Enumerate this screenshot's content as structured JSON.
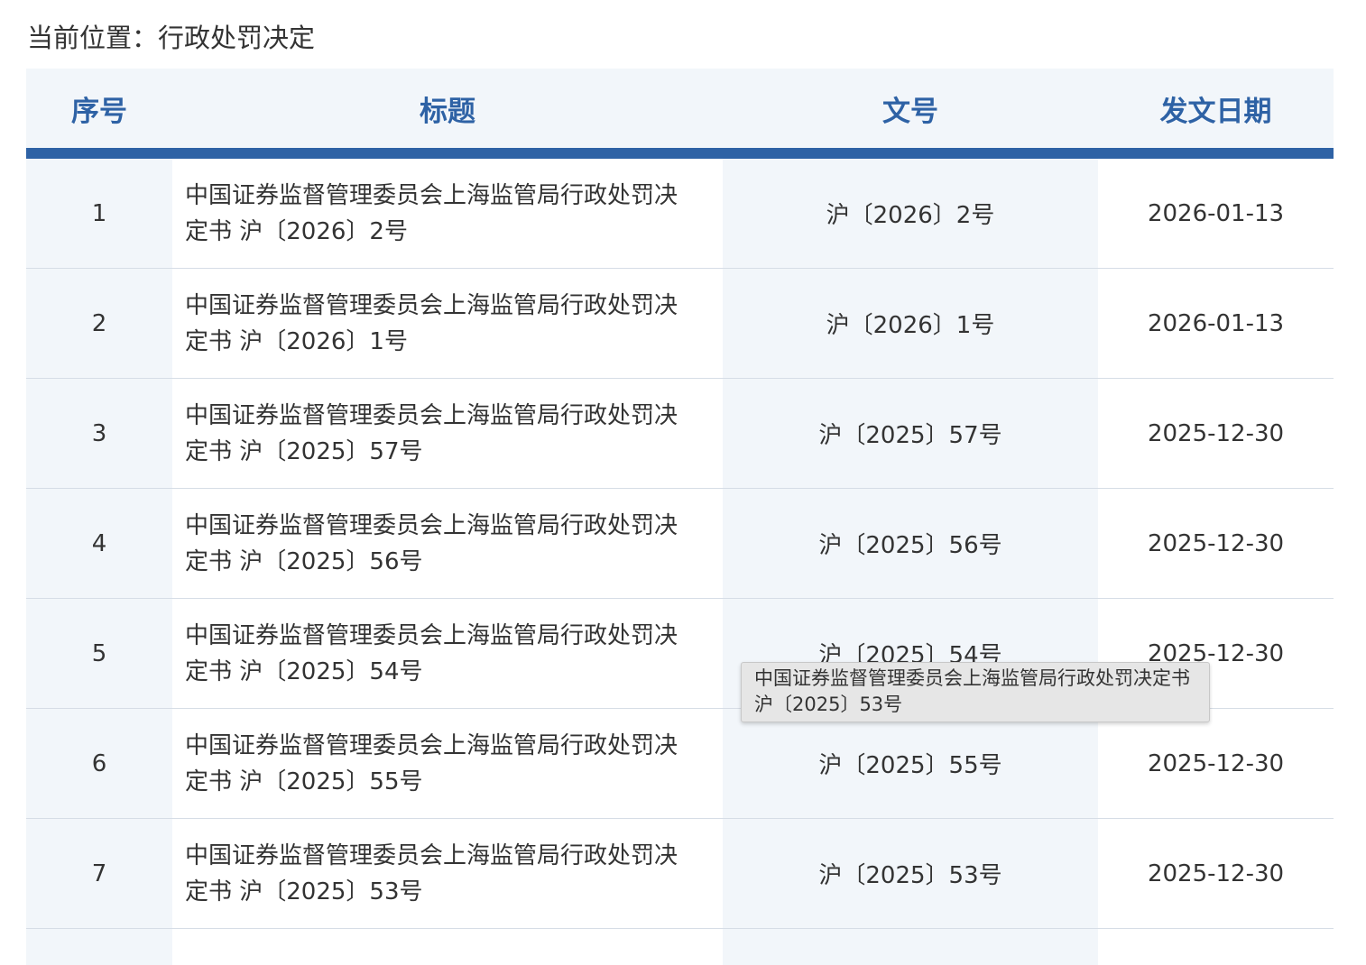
{
  "breadcrumb": "当前位置：行政处罚决定",
  "table": {
    "headers": {
      "index": "序号",
      "title": "标题",
      "doc_no": "文号",
      "date": "发文日期"
    },
    "rows": [
      {
        "index": "1",
        "title": "中国证券监督管理委员会上海监管局行政处罚决定书 沪〔2026〕2号",
        "doc_no": "沪〔2026〕2号",
        "date": "2026-01-13"
      },
      {
        "index": "2",
        "title": "中国证券监督管理委员会上海监管局行政处罚决定书 沪〔2026〕1号",
        "doc_no": "沪〔2026〕1号",
        "date": "2026-01-13"
      },
      {
        "index": "3",
        "title": "中国证券监督管理委员会上海监管局行政处罚决定书 沪〔2025〕57号",
        "doc_no": "沪〔2025〕57号",
        "date": "2025-12-30"
      },
      {
        "index": "4",
        "title": "中国证券监督管理委员会上海监管局行政处罚决定书 沪〔2025〕56号",
        "doc_no": "沪〔2025〕56号",
        "date": "2025-12-30"
      },
      {
        "index": "5",
        "title": "中国证券监督管理委员会上海监管局行政处罚决定书 沪〔2025〕54号",
        "doc_no": "沪〔2025〕54号",
        "date": "2025-12-30"
      },
      {
        "index": "6",
        "title": "中国证券监督管理委员会上海监管局行政处罚决定书 沪〔2025〕55号",
        "doc_no": "沪〔2025〕55号",
        "date": "2025-12-30"
      },
      {
        "index": "7",
        "title": "中国证券监督管理委员会上海监管局行政处罚决定书 沪〔2025〕53号",
        "doc_no": "沪〔2025〕53号",
        "date": "2025-12-30"
      }
    ]
  },
  "tooltip": "中国证券监督管理委员会上海监管局行政处罚决定书 沪〔2025〕53号",
  "colors": {
    "accent": "#2e62a5",
    "header_bg": "#f2f6fa",
    "text": "#333333"
  }
}
